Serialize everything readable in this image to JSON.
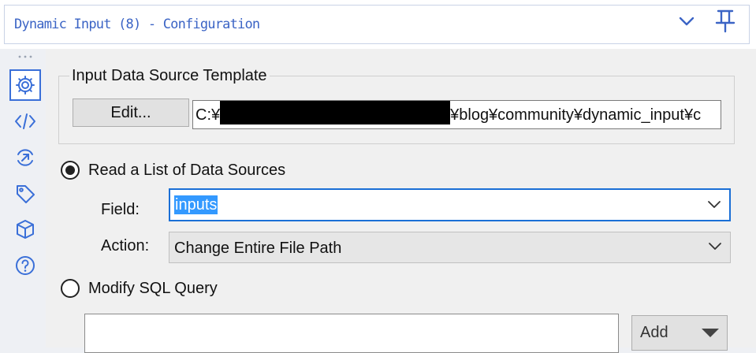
{
  "header": {
    "title": "Dynamic Input (8) - Configuration",
    "collapse_icon": "chevron-down-icon",
    "pin_icon": "pin-icon"
  },
  "sidebar": {
    "items": [
      {
        "icon": "gear-icon",
        "active": true
      },
      {
        "icon": "code-icon",
        "active": false
      },
      {
        "icon": "annotation-icon",
        "active": false
      },
      {
        "icon": "tag-icon",
        "active": false
      },
      {
        "icon": "cube-icon",
        "active": false
      },
      {
        "icon": "help-icon",
        "active": false
      }
    ]
  },
  "template_group": {
    "label": "Input Data Source Template",
    "edit_label": "Edit...",
    "path_prefix": "C:¥",
    "path_suffix": "¥blog¥community¥dynamic_input¥c"
  },
  "read_list": {
    "label": "Read a List of Data Sources",
    "selected": true,
    "field_label": "Field:",
    "field_value": "inputs",
    "action_label": "Action:",
    "action_value": "Change Entire File Path"
  },
  "modify_sql": {
    "label": "Modify SQL Query",
    "selected": false,
    "query_text": "",
    "add_label": "Add"
  },
  "colors": {
    "accent": "#3a6fd8",
    "title": "#3b64c5",
    "selection": "#3399ff"
  }
}
